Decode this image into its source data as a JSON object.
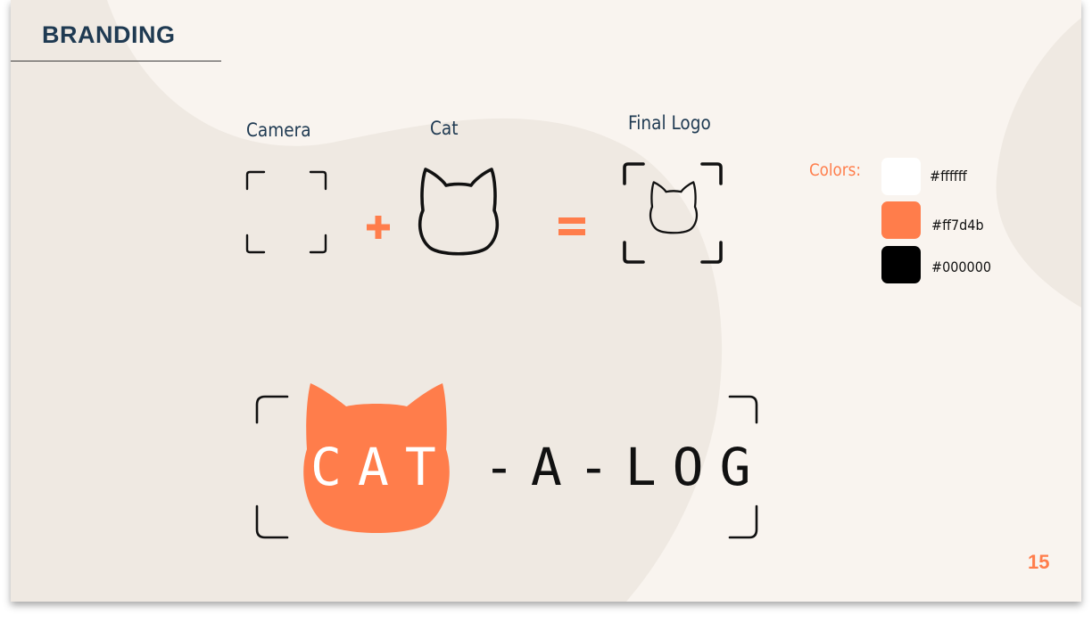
{
  "slide": {
    "title": "BRANDING",
    "page_number": "15"
  },
  "equation": {
    "items": [
      {
        "label": "Camera",
        "icon": "camera-frame-icon"
      },
      {
        "label": "Cat",
        "icon": "cat-head-outline-icon"
      },
      {
        "label": "Final Logo",
        "icon": "cat-in-frame-icon"
      }
    ],
    "plus_operator_icon": "plus-icon",
    "equals_operator_icon": "equals-icon"
  },
  "colors": {
    "label": "Colors:",
    "swatches": [
      {
        "hex": "#ffffff",
        "color": "#ffffff"
      },
      {
        "hex": "#ff7d4b",
        "color": "#ff7d4b"
      },
      {
        "hex": "#000000",
        "color": "#000000"
      }
    ]
  },
  "logo": {
    "cat_text": "CAT",
    "rest_text": "-A-LOG",
    "icon": "cat-head-filled-icon"
  },
  "palette": {
    "accent": "#ff7d4b",
    "title": "#1f3a52",
    "background": "#f9f4ef",
    "blob": "#efe9e2"
  }
}
